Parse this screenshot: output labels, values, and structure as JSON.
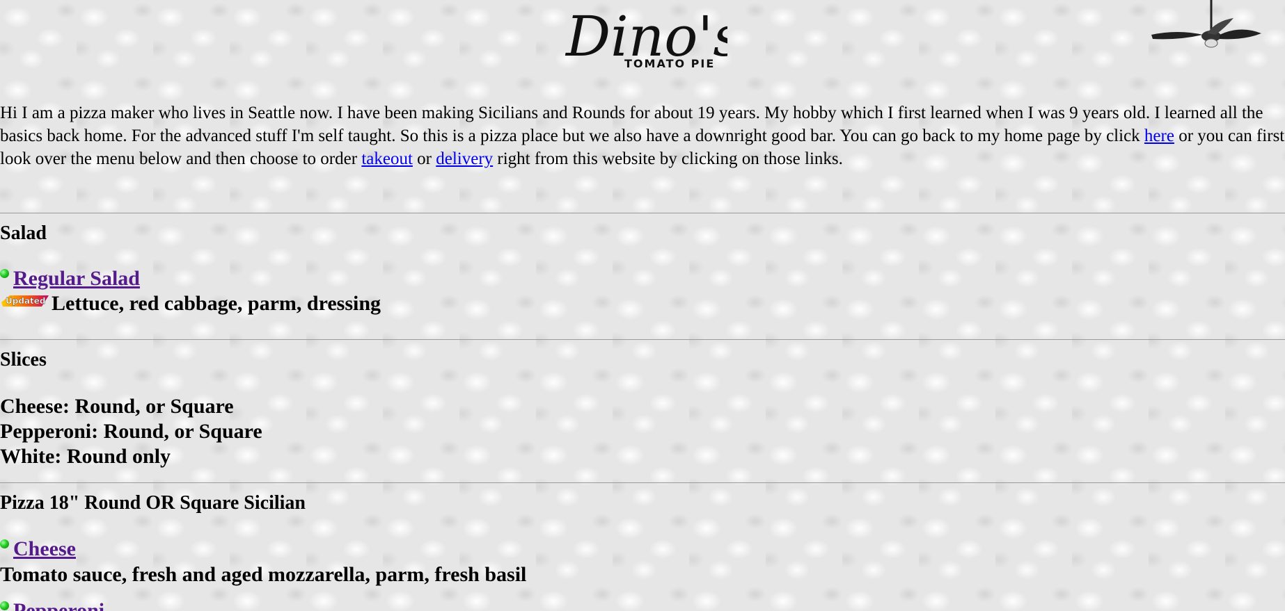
{
  "header": {
    "logo_script": "Dino's",
    "logo_sub": "TOMATO PIE",
    "fan_icon": "ceiling-fan-icon"
  },
  "intro": {
    "text_1": "Hi I am a pizza maker who lives in Seattle now. I have been making Sicilians and Rounds for about 19 years. My hobby which I first learned when I was 9 years old. I learned all the basics back home. For the advanced stuff I'm self taught. So this is a pizza place but we also have a downright good bar. You can go back to my home page by click ",
    "link_home": "here",
    "text_2": " or you can first look over the menu below and then choose to order ",
    "link_takeout": "takeout",
    "text_3": " or ",
    "link_delivery": "delivery",
    "text_4": " right from this website by clicking on those links."
  },
  "salad": {
    "heading": "Salad",
    "item_title": "Regular Salad",
    "badge": "Updated",
    "item_desc": "Lettuce, red cabbage, parm, dressing"
  },
  "slices": {
    "heading": "Slices",
    "lines": [
      "Cheese: Round, or Square",
      "Pepperoni: Round, or Square",
      "White: Round only"
    ]
  },
  "pizza": {
    "heading": "Pizza 18\" Round OR Square Sicilian",
    "item1_title": "Cheese",
    "item1_desc": "Tomato sauce, fresh and aged mozzarella, parm, fresh basil",
    "item2_title": "Pepperoni"
  },
  "colors": {
    "link": "#0000ee",
    "visited_link": "#551a8b",
    "bullet": "#22cc22"
  }
}
